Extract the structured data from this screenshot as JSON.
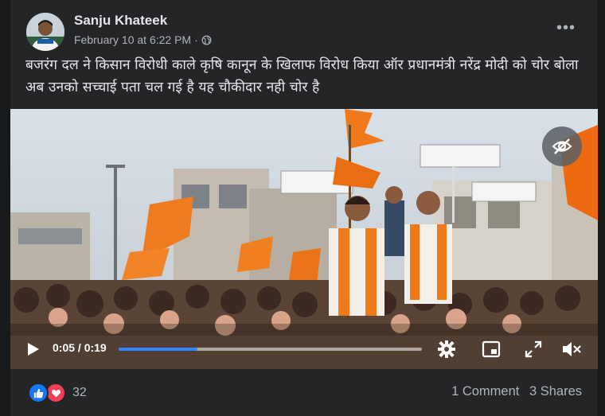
{
  "post": {
    "author": "Sanju Khateek",
    "date": "February 10 at 6:22 PM",
    "separator": "·",
    "audience_icon": "globe-icon",
    "more_icon": "more-options-icon",
    "text": "बजरंग दल ने किसान विरोधी काले कृषि कानून के खिलाफ विरोध किया ऑर प्रधानमंत्री नरेंद्र मोदी को चोर बोला अब उनको सच्चाई पता चल गई है यह चौकीदार नही चोर है"
  },
  "video": {
    "current_time": "0:05",
    "duration": "0:19",
    "time_display": "0:05 / 0:19",
    "progress": 0.26,
    "icons": [
      "play-icon",
      "settings-icon",
      "picture-in-picture-icon",
      "fullscreen-icon",
      "mute-icon",
      "hide-eye-icon"
    ]
  },
  "engagement": {
    "reaction_icons": [
      "like-icon",
      "love-icon"
    ],
    "reaction_count": "32",
    "comments": "1 Comment",
    "shares": "3 Shares"
  },
  "colors": {
    "background": "#18191a",
    "card": "#242526",
    "text_primary": "#e4e6eb",
    "text_secondary": "#b0b3b8",
    "accent": "#2d88ff",
    "like": "#1877f2",
    "love": "#f33e58",
    "saffron": "#f07a1a"
  }
}
